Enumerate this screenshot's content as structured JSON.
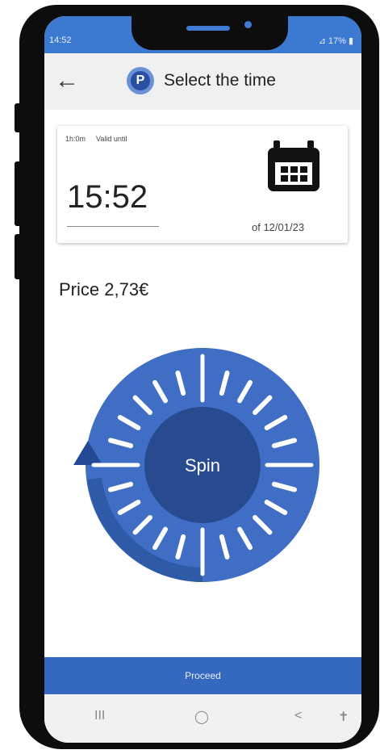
{
  "status": {
    "time": "14:52",
    "right": "⊿ 17% ▮"
  },
  "header": {
    "title": "Select the time",
    "logo_letter": "P"
  },
  "card": {
    "duration": "1h:0m",
    "valid_label": "Valid until",
    "time": "15:52",
    "date": "of 12/01/23"
  },
  "price": "Price 2,73€",
  "dial": {
    "label": "Spin"
  },
  "proceed_label": "Proceed",
  "navbar": {
    "recents": "III",
    "home": "◯",
    "back": "<",
    "accessibility": "✝"
  },
  "colors": {
    "primary": "#3568bf",
    "dial_outer": "#3f6ec4",
    "dial_inner": "#284a8e",
    "status": "#3c79d1"
  }
}
